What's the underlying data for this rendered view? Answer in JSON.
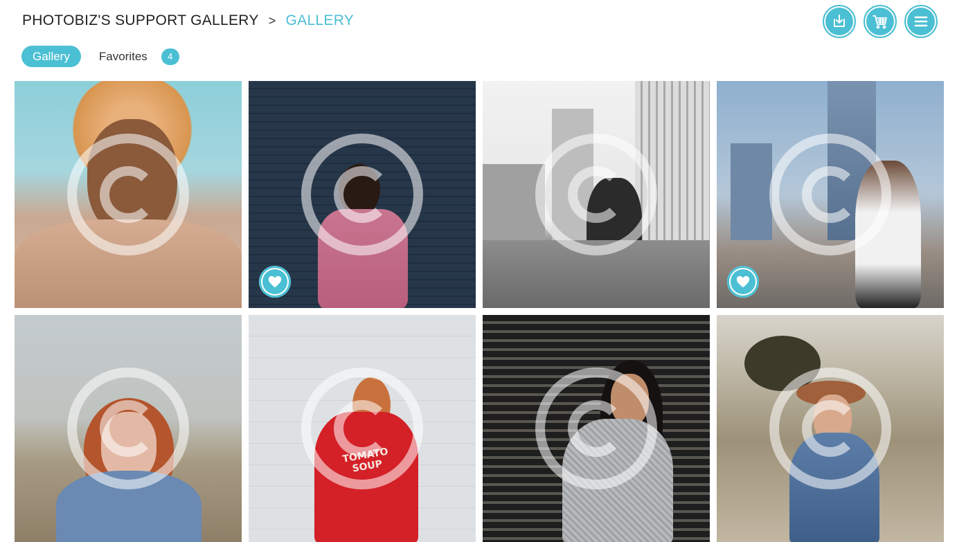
{
  "breadcrumb": {
    "root": "PHOTOBIZ'S SUPPORT GALLERY",
    "separator": ">",
    "current": "GALLERY"
  },
  "actions": [
    {
      "name": "download-button",
      "icon": "download-icon"
    },
    {
      "name": "cart-button",
      "icon": "cart-icon"
    },
    {
      "name": "menu-button",
      "icon": "hamburger-menu-icon"
    }
  ],
  "tabs": {
    "active": "Gallery",
    "favorites": "Favorites",
    "favorites_count": "4"
  },
  "photos": [
    {
      "subject": "woman-curly-hair-fur-coat",
      "favorited": false
    },
    {
      "subject": "woman-pink-dress-dark-wall",
      "favorited": true
    },
    {
      "subject": "woman-sitting-rooftop-bw",
      "favorited": false
    },
    {
      "subject": "woman-sunglasses-city-skyline",
      "favorited": true
    },
    {
      "subject": "woman-red-hair-field",
      "favorited": false
    },
    {
      "subject": "woman-red-sweatshirt-white-wall",
      "favorited": false,
      "shirt_text": "TOMATO SOUP"
    },
    {
      "subject": "woman-grey-sweater-striped-wall",
      "favorited": false
    },
    {
      "subject": "woman-hat-denim-jacket-field",
      "favorited": false
    }
  ],
  "colors": {
    "accent": "#4bbfd3"
  }
}
